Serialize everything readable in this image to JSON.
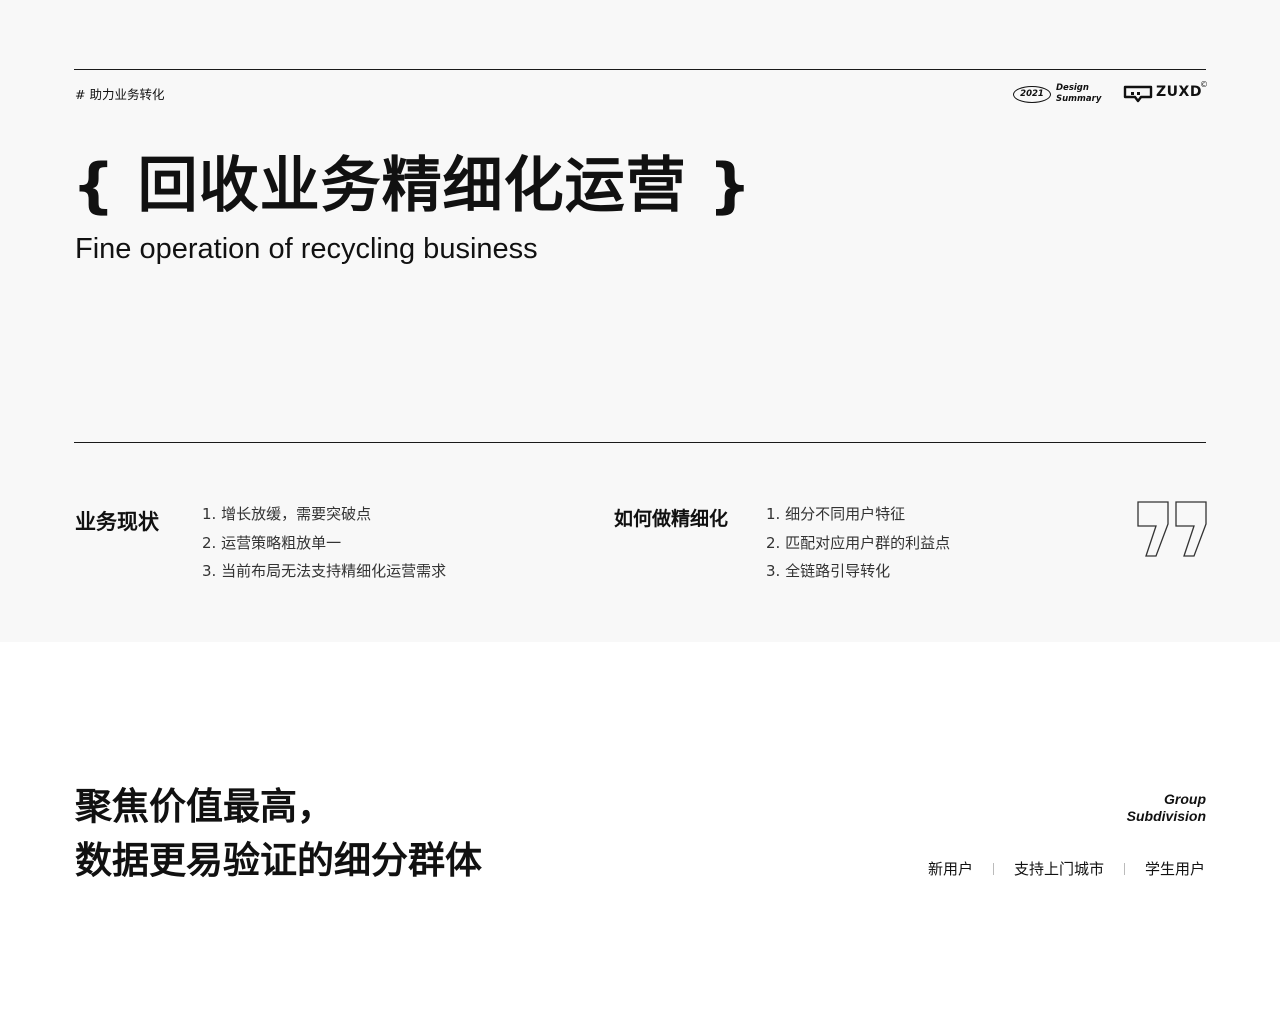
{
  "header": {
    "tag": "# 助力业务转化",
    "logo_year": "2021",
    "logo_design": "Design",
    "logo_summary": "Summary",
    "brand": "ZUXD",
    "brand_mark": "©"
  },
  "hero": {
    "title": "{ 回收业务精细化运营 }",
    "subtitle": "Fine operation of recycling business"
  },
  "status": {
    "heading": "业务现状",
    "items": [
      "1. 增长放缓，需要突破点",
      "2. 运营策略粗放单一",
      "3. 当前布局无法支持精细化运营需求"
    ]
  },
  "approach": {
    "heading": "如何做精细化",
    "items": [
      "1. 细分不同用户特征",
      "2. 匹配对应用户群的利益点",
      "3. 全链路引导转化"
    ]
  },
  "focus": {
    "line1": "聚焦价值最高，",
    "line2": "数据更易验证的细分群体",
    "group_line1": "Group",
    "group_line2": "Subdivision",
    "segments": [
      "新用户",
      "支持上门城市",
      "学生用户"
    ]
  },
  "icons": {
    "quote": "quote-icon",
    "brand_logo": "zuxd-logo-icon"
  },
  "colors": {
    "panel_bg": "#f8f8f8",
    "text": "#111111",
    "rule": "#1a1a1a"
  }
}
